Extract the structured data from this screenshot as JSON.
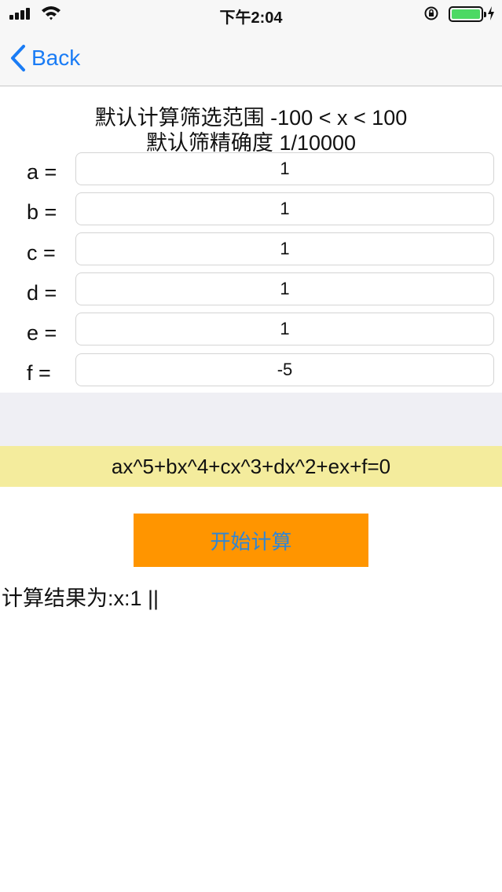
{
  "status_bar": {
    "time": "下午2:04"
  },
  "nav": {
    "back_label": "Back"
  },
  "header": {
    "line1": "默认计算筛选范围 -100 < x < 100",
    "line2": "默认筛精确度 1/10000"
  },
  "coefficients": [
    {
      "label": "a =",
      "value": "1"
    },
    {
      "label": "b =",
      "value": "1"
    },
    {
      "label": "c =",
      "value": "1"
    },
    {
      "label": "d =",
      "value": "1"
    },
    {
      "label": "e =",
      "value": "1"
    },
    {
      "label": "f =",
      "value": "-5"
    }
  ],
  "equation": "ax^5+bx^4+cx^3+dx^2+ex+f=0",
  "start_button_label": "开始计算",
  "result_text": "计算结果为:x:1 ||",
  "colors": {
    "accent": "#1a7cf5",
    "button_bg": "#ff9500",
    "button_text": "#2f86d6",
    "equation_bg": "#f4ec9d",
    "battery": "#4cd964"
  }
}
